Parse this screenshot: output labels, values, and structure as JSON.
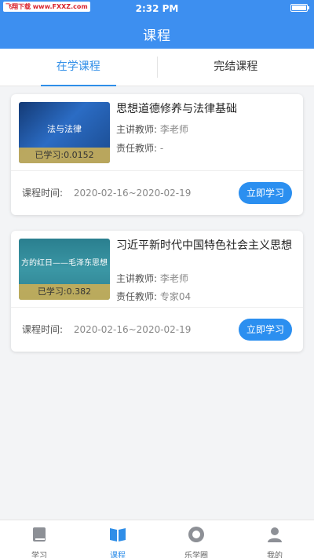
{
  "status_bar": {
    "watermark": "飞翔下载 www.FXXZ.com",
    "time": "2:32 PM",
    "battery_level": 1.0
  },
  "header": {
    "title": "课程"
  },
  "tabs": [
    {
      "label": "在学课程",
      "active": true
    },
    {
      "label": "完结课程",
      "active": false
    }
  ],
  "courses": [
    {
      "thumb_text": "法与法律",
      "progress_text": "已学习:0.0152",
      "title": "思想道德修养与法律基础",
      "teacher_label": "主讲教师:",
      "teacher": "李老师",
      "responsible_label": "责任教师:",
      "responsible": "-",
      "time_label": "课程时间:",
      "time": "2020-02-16~2020-02-19",
      "button_label": "立即学习"
    },
    {
      "thumb_text": "方的红日——毛泽东思想",
      "progress_text": "已学习:0.382",
      "title": "习近平新时代中国特色社会主义思想",
      "teacher_label": "主讲教师:",
      "teacher": "李老师",
      "responsible_label": "责任教师:",
      "responsible": "专家04",
      "time_label": "课程时间:",
      "time": "2020-02-16~2020-02-19",
      "button_label": "立即学习"
    }
  ],
  "bottom_nav": [
    {
      "label": "学习",
      "icon": "book-icon",
      "active": false
    },
    {
      "label": "课程",
      "icon": "open-book-icon",
      "active": true
    },
    {
      "label": "乐学圈",
      "icon": "circle-icon",
      "active": false
    },
    {
      "label": "我的",
      "icon": "person-icon",
      "active": false
    }
  ],
  "colors": {
    "primary": "#3d8ff0",
    "button": "#2b8ff0",
    "progress_bg": "#c7ae58"
  }
}
